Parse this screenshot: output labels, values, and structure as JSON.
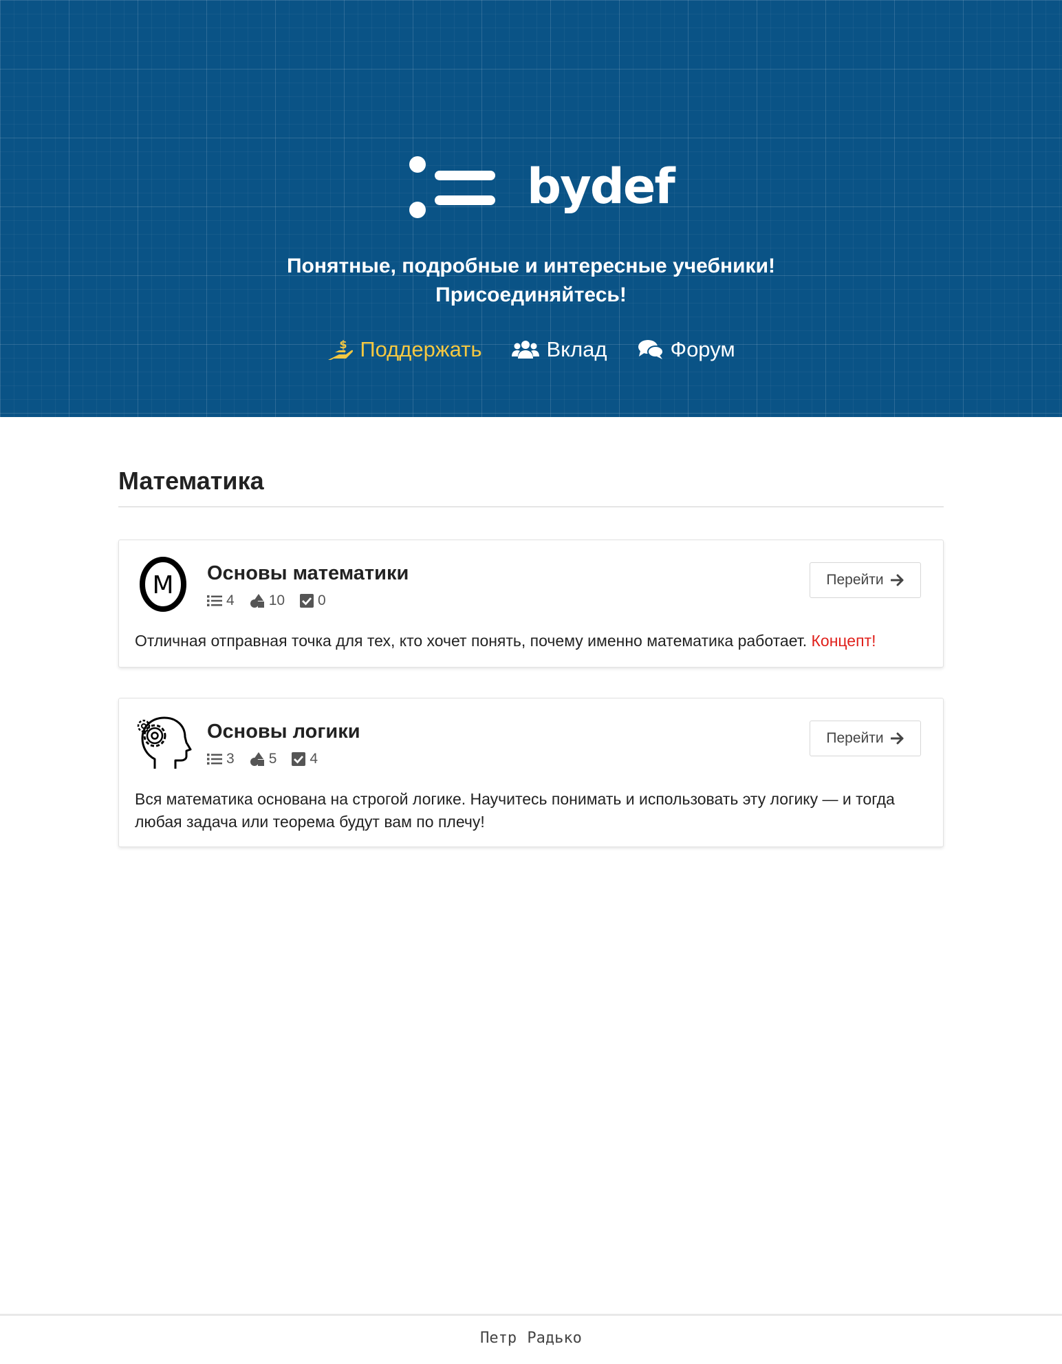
{
  "header": {
    "logo_text": "bydef",
    "tagline_line1": "Понятные, подробные и интересные учебники!",
    "tagline_line2": "Присоединяйтесь!",
    "nav": [
      {
        "label": "Поддержать",
        "icon": "hand-coin-icon",
        "color": "#f5c842"
      },
      {
        "label": "Вклад",
        "icon": "users-icon",
        "color": "#ffffff"
      },
      {
        "label": "Форум",
        "icon": "comments-icon",
        "color": "#ffffff"
      }
    ]
  },
  "section": {
    "title": "Математика"
  },
  "courses": [
    {
      "title": "Основы математики",
      "icon": "letter-m-circle-icon",
      "icon_letter": "M",
      "stats": {
        "lessons": "4",
        "shapes": "10",
        "tasks": "0"
      },
      "button_label": "Перейти",
      "description": "Отличная отправная точка для тех, кто хочет понять, почему именно математика работает.",
      "badge": "Концепт!"
    },
    {
      "title": "Основы логики",
      "icon": "head-gear-icon",
      "stats": {
        "lessons": "3",
        "shapes": "5",
        "tasks": "4"
      },
      "button_label": "Перейти",
      "description": "Вся математика основана на строгой логике. Научитесь понимать и использовать эту логику — и тогда любая задача или теорема будут вам по плечу!"
    }
  ],
  "footer": {
    "author": "Петр Радько"
  },
  "colors": {
    "hero_background": "#0a5386",
    "accent_support": "#f5c842",
    "concept_red": "#e0201b"
  }
}
